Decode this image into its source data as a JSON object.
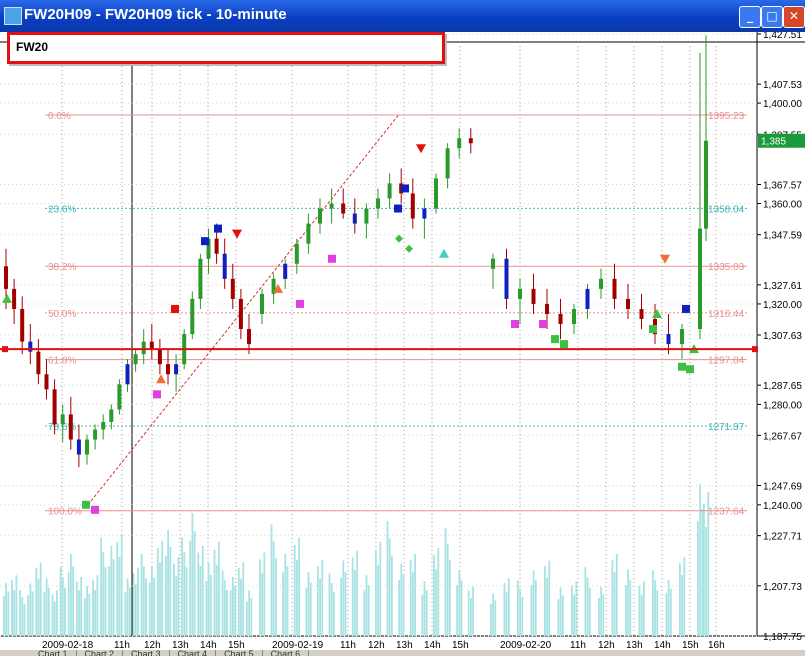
{
  "window": {
    "title": "FW20H09 - FW20H09 tick - 10-minute",
    "buttons": [
      "_",
      "□",
      "✕"
    ]
  },
  "symbol_label": "FW20",
  "tabs": [
    "Chart 1",
    "Chart 2",
    "Chart 3",
    "Chart 4",
    "Chart 5",
    "Chart 6"
  ],
  "colors": {
    "bull": "#2a9a2a",
    "bear": "#a00000",
    "blue": "#1020c0",
    "fib_red": "#e89090",
    "fib_cyan": "#40b8b8",
    "volume": "#a8e2e2",
    "hline": "#e01010"
  },
  "price_axis_labels": [
    "1,427.51",
    "1,407.53",
    "1,400.00",
    "1,387.55",
    "1,367.57",
    "1,360.00",
    "1,347.59",
    "1,327.61",
    "1,320.00",
    "1,307.63",
    "1,287.65",
    "1,280.00",
    "1,267.67",
    "1,247.69",
    "1,240.00",
    "1,227.71",
    "1,207.73",
    "1,187.75"
  ],
  "current_price_tag": "1,385",
  "fib_levels": [
    {
      "pct": "0.0%",
      "price": "1395.23"
    },
    {
      "pct": "23.6%",
      "price": "1358.04"
    },
    {
      "pct": "38.2%",
      "price": "1335.03"
    },
    {
      "pct": "50.0%",
      "price": "1316.44"
    },
    {
      "pct": "61.8%",
      "price": "1297.84"
    },
    {
      "pct": "78.6%",
      "price": "1271.37"
    },
    {
      "pct": "100.0%",
      "price": "1237.64"
    }
  ],
  "time_axis_labels": [
    "2009-02-18",
    "11h",
    "12h",
    "13h",
    "14h",
    "15h",
    "2009-02-19",
    "11h",
    "12h",
    "13h",
    "14h",
    "15h",
    "2009-02-20",
    "11h",
    "12h",
    "13h",
    "14h",
    "15h",
    "16h"
  ],
  "chart_data": {
    "type": "candlestick",
    "ylim": [
      1187.75,
      1427.51
    ],
    "horizontal_line": 1302.0,
    "bars": [
      [
        1335,
        1342,
        1318,
        1326
      ],
      [
        1326,
        1330,
        1312,
        1318
      ],
      [
        1318,
        1323,
        1300,
        1305
      ],
      [
        1305,
        1312,
        1296,
        1301
      ],
      [
        1301,
        1306,
        1288,
        1292
      ],
      [
        1292,
        1298,
        1282,
        1286
      ],
      [
        1286,
        1290,
        1268,
        1272
      ],
      [
        1272,
        1280,
        1265,
        1276
      ],
      [
        1276,
        1283,
        1262,
        1266
      ],
      [
        1266,
        1272,
        1255,
        1260
      ],
      [
        1260,
        1268,
        1256,
        1266
      ],
      [
        1266,
        1272,
        1262,
        1270
      ],
      [
        1270,
        1276,
        1266,
        1273
      ],
      [
        1273,
        1280,
        1270,
        1278
      ],
      [
        1278,
        1290,
        1276,
        1288
      ],
      [
        1288,
        1298,
        1285,
        1296
      ],
      [
        1296,
        1302,
        1293,
        1300
      ],
      [
        1300,
        1310,
        1296,
        1305
      ],
      [
        1305,
        1312,
        1298,
        1302
      ],
      [
        1302,
        1306,
        1292,
        1296
      ],
      [
        1296,
        1302,
        1288,
        1292
      ],
      [
        1292,
        1300,
        1285,
        1296
      ],
      [
        1296,
        1310,
        1294,
        1308
      ],
      [
        1308,
        1325,
        1306,
        1322
      ],
      [
        1322,
        1340,
        1318,
        1338
      ],
      [
        1338,
        1350,
        1332,
        1346
      ],
      [
        1346,
        1352,
        1336,
        1340
      ],
      [
        1340,
        1346,
        1326,
        1330
      ],
      [
        1330,
        1336,
        1318,
        1322
      ],
      [
        1322,
        1326,
        1306,
        1310
      ],
      [
        1310,
        1316,
        1300,
        1304
      ],
      [
        1316,
        1326,
        1312,
        1324
      ],
      [
        1324,
        1332,
        1320,
        1330
      ],
      [
        1330,
        1338,
        1326,
        1336
      ],
      [
        1336,
        1346,
        1332,
        1344
      ],
      [
        1344,
        1356,
        1340,
        1352
      ],
      [
        1352,
        1362,
        1348,
        1358
      ],
      [
        1358,
        1366,
        1352,
        1360
      ],
      [
        1360,
        1366,
        1354,
        1356
      ],
      [
        1356,
        1362,
        1348,
        1352
      ],
      [
        1352,
        1360,
        1346,
        1358
      ],
      [
        1358,
        1366,
        1354,
        1362
      ],
      [
        1362,
        1372,
        1358,
        1368
      ],
      [
        1368,
        1374,
        1360,
        1364
      ],
      [
        1364,
        1370,
        1350,
        1354
      ],
      [
        1354,
        1362,
        1346,
        1358
      ],
      [
        1358,
        1372,
        1356,
        1370
      ],
      [
        1370,
        1384,
        1366,
        1382
      ],
      [
        1382,
        1390,
        1378,
        1386
      ],
      [
        1386,
        1390,
        1380,
        1384
      ],
      [
        1334,
        1340,
        1326,
        1338
      ],
      [
        1338,
        1342,
        1318,
        1322
      ],
      [
        1322,
        1330,
        1312,
        1326
      ],
      [
        1326,
        1332,
        1316,
        1320
      ],
      [
        1320,
        1326,
        1310,
        1316
      ],
      [
        1316,
        1322,
        1306,
        1312
      ],
      [
        1312,
        1320,
        1308,
        1318
      ],
      [
        1318,
        1328,
        1314,
        1326
      ],
      [
        1326,
        1334,
        1322,
        1330
      ],
      [
        1330,
        1336,
        1318,
        1322
      ],
      [
        1322,
        1328,
        1314,
        1318
      ],
      [
        1318,
        1324,
        1310,
        1314
      ],
      [
        1314,
        1320,
        1304,
        1308
      ],
      [
        1308,
        1316,
        1300,
        1304
      ],
      [
        1304,
        1312,
        1298,
        1310
      ],
      [
        1310,
        1420,
        1306,
        1350
      ],
      [
        1350,
        1427,
        1345,
        1385
      ]
    ],
    "bar_colors": "bear,bear,bear,bear,bear,bear,bear,bull,bear,bear,bull,bull,bull,bull,bull,bull,bull,bull,bear,bear,bear,bull,bull,bull,bull,bull,bear,bear,bear,bear,bear,bull,bull,bull,bull,bull,bull,bull,bear,bear,bull,bull,bull,bear,bear,bull,bull,bull,bull,bear,bull,bear,bull,bear,bear,bear,bull,bull,bull,bear,bear,bear,bear,bear,bull,bull,bull",
    "volume": [
      0.35,
      0.4,
      0.28,
      0.32,
      0.45,
      0.38,
      0.3,
      0.42,
      0.5,
      0.36,
      0.33,
      0.4,
      0.6,
      0.55,
      0.62,
      0.38,
      0.45,
      0.5,
      0.42,
      0.58,
      0.7,
      0.52,
      0.6,
      0.75,
      0.55,
      0.48,
      0.62,
      0.4,
      0.36,
      0.45,
      0.3,
      0.55,
      0.68,
      0.5,
      0.6,
      0.42,
      0.5,
      0.38,
      0.46,
      0.52,
      0.4,
      0.62,
      0.7,
      0.44,
      0.5,
      0.36,
      0.58,
      0.66,
      0.4,
      0.3,
      0.28,
      0.38,
      0.34,
      0.4,
      0.46,
      0.32,
      0.36,
      0.42,
      0.3,
      0.5,
      0.44,
      0.36,
      0.4,
      0.34,
      0.48,
      1.0,
      0.95
    ]
  }
}
